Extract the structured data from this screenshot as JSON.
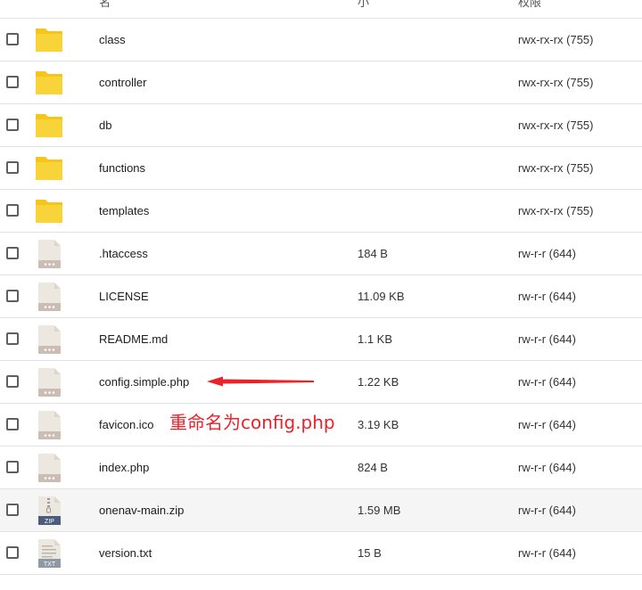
{
  "header": {
    "name_label": "名",
    "size_label": "小",
    "perm_label": "权限"
  },
  "files": [
    {
      "name": "class",
      "size": "",
      "permissions": "rwx-rx-rx (755)",
      "type": "folder"
    },
    {
      "name": "controller",
      "size": "",
      "permissions": "rwx-rx-rx (755)",
      "type": "folder"
    },
    {
      "name": "db",
      "size": "",
      "permissions": "rwx-rx-rx (755)",
      "type": "folder"
    },
    {
      "name": "functions",
      "size": "",
      "permissions": "rwx-rx-rx (755)",
      "type": "folder"
    },
    {
      "name": "templates",
      "size": "",
      "permissions": "rwx-rx-rx (755)",
      "type": "folder"
    },
    {
      "name": ".htaccess",
      "size": "184 B",
      "permissions": "rw-r-r (644)",
      "type": "file"
    },
    {
      "name": "LICENSE",
      "size": "11.09 KB",
      "permissions": "rw-r-r (644)",
      "type": "file"
    },
    {
      "name": "README.md",
      "size": "1.1 KB",
      "permissions": "rw-r-r (644)",
      "type": "file"
    },
    {
      "name": "config.simple.php",
      "size": "1.22 KB",
      "permissions": "rw-r-r (644)",
      "type": "file"
    },
    {
      "name": "favicon.ico",
      "size": "3.19 KB",
      "permissions": "rw-r-r (644)",
      "type": "file"
    },
    {
      "name": "index.php",
      "size": "824 B",
      "permissions": "rw-r-r (644)",
      "type": "file"
    },
    {
      "name": "onenav-main.zip",
      "size": "1.59 MB",
      "permissions": "rw-r-r (644)",
      "type": "zip",
      "badge": "ZIP"
    },
    {
      "name": "version.txt",
      "size": "15 B",
      "permissions": "rw-r-r (644)",
      "type": "txt",
      "badge": "TXT"
    }
  ],
  "annotation": {
    "text": "重命名为config.php",
    "color": "#e8232a"
  },
  "colors": {
    "folder": "#f5c518",
    "file_body": "#ece8e0",
    "file_band": "#c9bdb4",
    "zip_band": "#4b5d7d",
    "txt_band": "#8e9aa3"
  }
}
